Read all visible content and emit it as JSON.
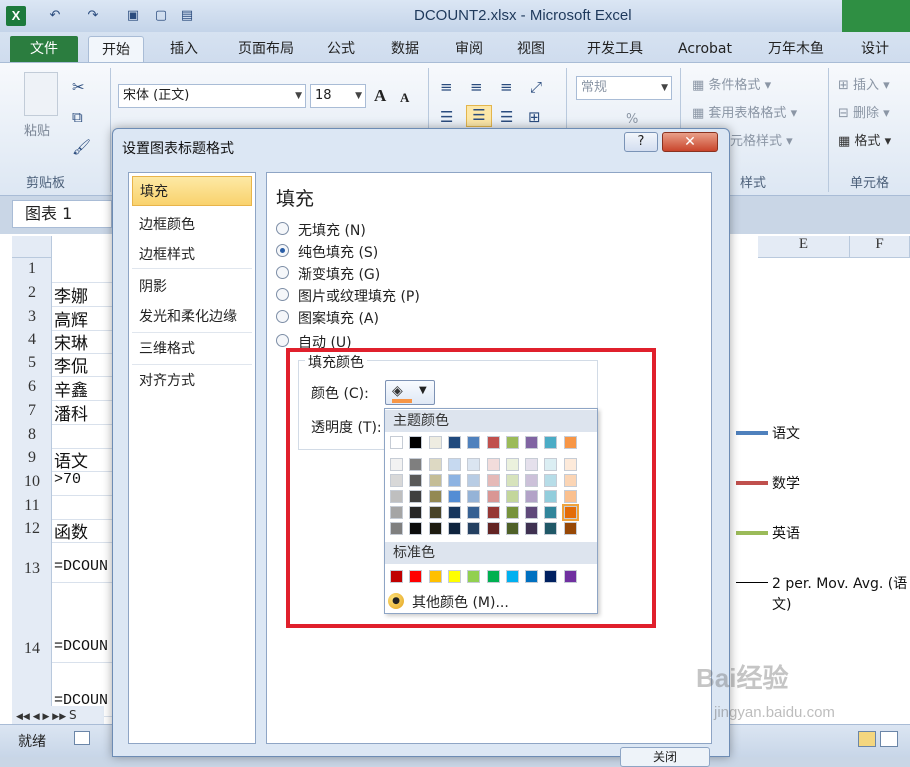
{
  "window": {
    "title": "DCOUNT2.xlsx - Microsoft Excel",
    "app_icon": "X",
    "qat_icons": [
      "excel-icon",
      "undo-icon",
      "redo-icon",
      "save-icon",
      "new-icon",
      "open-icon"
    ]
  },
  "ribbon": {
    "file_tab": "文件",
    "tabs": [
      "开始",
      "插入",
      "页面布局",
      "公式",
      "数据",
      "审阅",
      "视图",
      "开发工具",
      "Acrobat",
      "万年木鱼",
      "设计"
    ],
    "active_tab": "开始",
    "clipboard": {
      "paste_label": "粘贴",
      "group_label": "剪贴板"
    },
    "font": {
      "name": "宋体 (正文)",
      "size": "18",
      "grow_label": "A",
      "shrink_label": "A"
    },
    "number": {
      "format": "常规",
      "percent": "%"
    },
    "styles": {
      "conditional": "条件格式",
      "table_format": "套用表格格式",
      "cell_styles": "元格样式",
      "group_label": "样式"
    },
    "cells": {
      "insert": "插入",
      "delete": "删除",
      "format": "格式",
      "group_label": "单元格"
    }
  },
  "namebox": "图表 1",
  "sheet": {
    "columns_visible": [
      "E",
      "F"
    ],
    "rows": [
      {
        "num": "1",
        "value": ""
      },
      {
        "num": "2",
        "value": "李娜"
      },
      {
        "num": "3",
        "value": "高辉"
      },
      {
        "num": "4",
        "value": "宋琳"
      },
      {
        "num": "5",
        "value": "李侃"
      },
      {
        "num": "6",
        "value": "辛鑫"
      },
      {
        "num": "7",
        "value": "潘科"
      },
      {
        "num": "8",
        "value": ""
      },
      {
        "num": "9",
        "value": "语文"
      },
      {
        "num": "10",
        "value": ">70"
      },
      {
        "num": "11",
        "value": ""
      },
      {
        "num": "12",
        "value": "函数"
      },
      {
        "num": "13",
        "value": "=DCOUN"
      },
      {
        "num": "14",
        "value": "=DCOUN"
      },
      {
        "num": "",
        "value": "=DCOUN"
      }
    ]
  },
  "chart_legend": [
    {
      "label": "语文",
      "color": "#4f81bd"
    },
    {
      "label": "数学",
      "color": "#c0504d"
    },
    {
      "label": "英语",
      "color": "#9bbb59"
    },
    {
      "label": "2 per. Mov. Avg. (语文)",
      "color": "#000000"
    }
  ],
  "status": {
    "ready": "就绪",
    "sheet_tab_prefix": "S"
  },
  "dialog": {
    "title": "设置图表标题格式",
    "help": "?",
    "close": "✕",
    "nav": [
      "填充",
      "边框颜色",
      "边框样式",
      "阴影",
      "发光和柔化边缘",
      "三维格式",
      "对齐方式"
    ],
    "selected_nav": "填充",
    "panel_title": "填充",
    "fill_options": [
      {
        "label": "无填充 (N)",
        "checked": false
      },
      {
        "label": "纯色填充 (S)",
        "checked": true
      },
      {
        "label": "渐变填充 (G)",
        "checked": false
      },
      {
        "label": "图片或纹理填充 (P)",
        "checked": false
      },
      {
        "label": "图案填充 (A)",
        "checked": false
      },
      {
        "label": "自动 (U)",
        "checked": false
      }
    ],
    "fill_color_group": "填充颜色",
    "color_label": "颜色 (C):",
    "transparency_label": "透明度 (T):",
    "current_color": "#f79646",
    "bottom_button": "关闭"
  },
  "color_picker": {
    "theme_header": "主题颜色",
    "standard_header": "标准色",
    "more_colors": "其他颜色 (M)...",
    "theme_top": [
      "#ffffff",
      "#000000",
      "#eeece1",
      "#1f497d",
      "#4f81bd",
      "#c0504d",
      "#9bbb59",
      "#8064a2",
      "#4bacc6",
      "#f79646"
    ],
    "theme_shades": [
      [
        "#f2f2f2",
        "#7f7f7f",
        "#ddd9c3",
        "#c6d9f0",
        "#dbe5f1",
        "#f2dcdb",
        "#ebf1dd",
        "#e5e0ec",
        "#dbeef3",
        "#fdeada"
      ],
      [
        "#d8d8d8",
        "#595959",
        "#c4bd97",
        "#8db3e2",
        "#b8cce4",
        "#e5b9b7",
        "#d7e3bc",
        "#ccc1d9",
        "#b7dde8",
        "#fbd5b5"
      ],
      [
        "#bfbfbf",
        "#3f3f3f",
        "#938953",
        "#548dd4",
        "#95b3d7",
        "#d99694",
        "#c3d69b",
        "#b2a2c7",
        "#92cddc",
        "#fac08f"
      ],
      [
        "#a5a5a5",
        "#262626",
        "#494429",
        "#17365d",
        "#366092",
        "#953734",
        "#76923c",
        "#5f497a",
        "#31859b",
        "#e36c09"
      ],
      [
        "#7f7f7f",
        "#0c0c0c",
        "#1d1b10",
        "#0f243e",
        "#244061",
        "#632423",
        "#4f6128",
        "#3f3151",
        "#205867",
        "#974806"
      ]
    ],
    "selected_swatch": "#e36c09",
    "standard": [
      "#c00000",
      "#ff0000",
      "#ffc000",
      "#ffff00",
      "#92d050",
      "#00b050",
      "#00b0f0",
      "#0070c0",
      "#002060",
      "#7030a0"
    ]
  },
  "watermark": {
    "brand": "Bai经验",
    "url": "jingyan.baidu.com"
  }
}
